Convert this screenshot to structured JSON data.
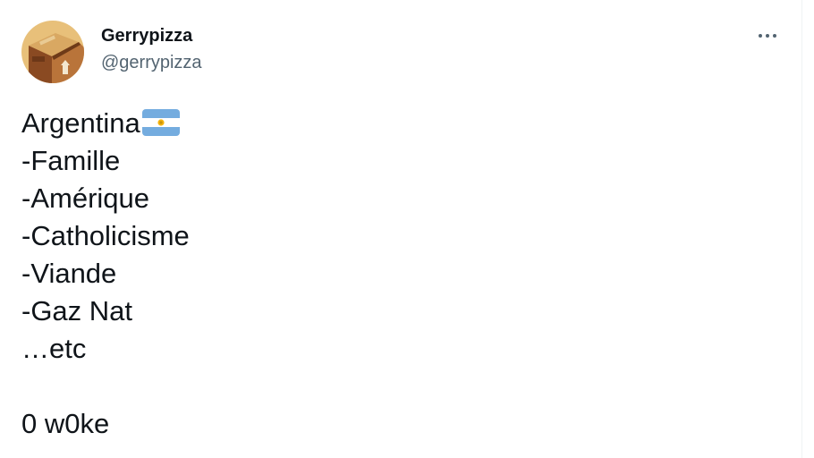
{
  "tweet": {
    "author": {
      "display_name": "Gerrypizza",
      "handle": "@gerrypizza",
      "avatar_icon": "cardboard-box-avatar-icon"
    },
    "more_icon": "more-options-icon",
    "text_lines": [
      "Argentina",
      "-Famille",
      "-Amérique",
      "-Catholicisme",
      "-Viande",
      "-Gaz Nat",
      "…etc",
      "",
      "0 w0ke"
    ],
    "flag_icon": "argentina-flag-icon",
    "colors": {
      "text": "#0f1419",
      "secondary_text": "#536471",
      "flag_blue": "#74acdf",
      "flag_sun": "#f6b40e"
    }
  }
}
